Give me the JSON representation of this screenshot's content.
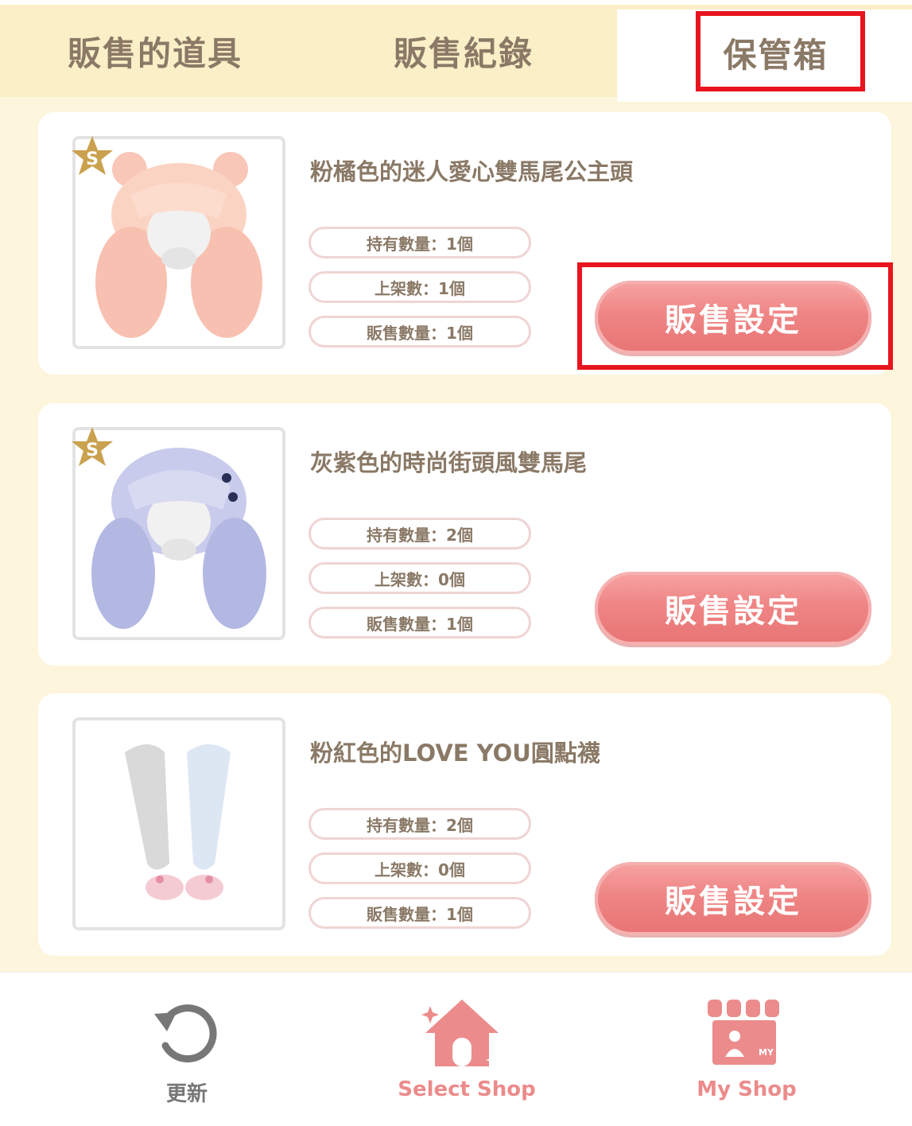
{
  "tabs": [
    {
      "label": "販售的道具"
    },
    {
      "label": "販售紀錄"
    },
    {
      "label": "保管箱"
    }
  ],
  "items": [
    {
      "title": "粉橘色的迷人愛心雙馬尾公主頭",
      "owned": "持有數量：1個",
      "listed": "上架數：1個",
      "sold": "販售數量：1個",
      "badge": "S",
      "button": "販售設定"
    },
    {
      "title": "灰紫色的時尚街頭風雙馬尾",
      "owned": "持有數量：2個",
      "listed": "上架數：0個",
      "sold": "販售數量：1個",
      "badge": "S",
      "button": "販售設定"
    },
    {
      "title": "粉紅色的LOVE YOU圓點襪",
      "owned": "持有數量：2個",
      "listed": "上架數：0個",
      "sold": "販售數量：1個",
      "button": "販售設定"
    }
  ],
  "bottom_nav": {
    "refresh": "更新",
    "select_shop": "Select Shop",
    "my_shop": "My Shop",
    "my_badge": "MY"
  },
  "colors": {
    "accent": "#ef8585",
    "highlight": "#e8141e",
    "text": "#8a7966",
    "background": "#fdf5dc"
  },
  "icons": {
    "refresh": "refresh-icon",
    "select_shop": "house-sparkle-icon",
    "my_shop": "storefront-icon",
    "badge": "star-s-icon"
  }
}
